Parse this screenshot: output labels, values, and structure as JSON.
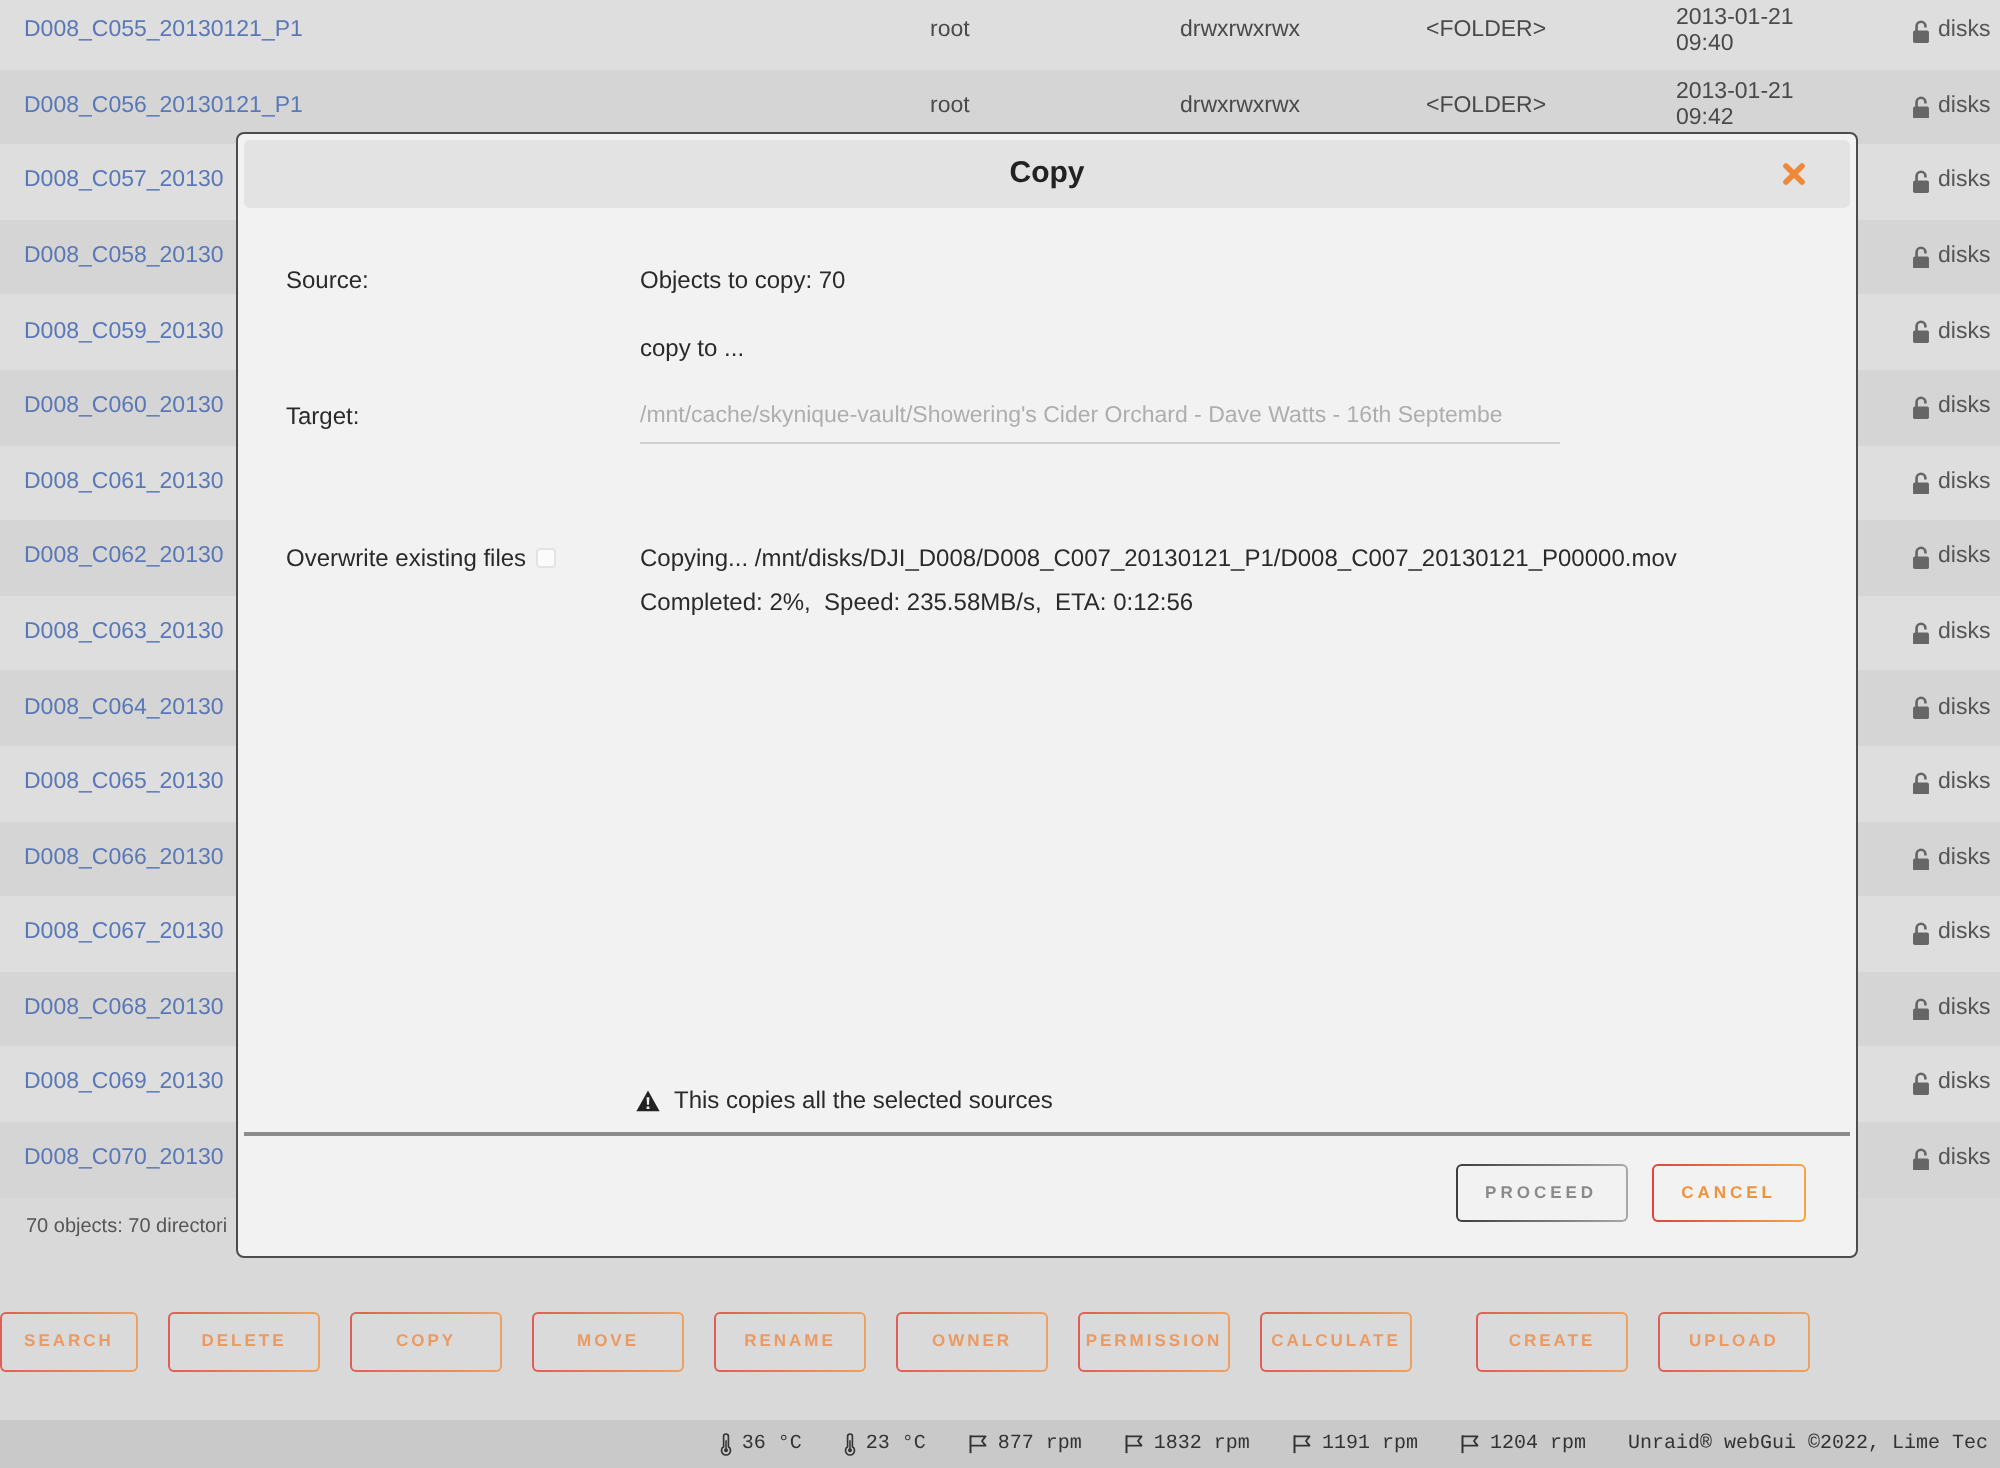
{
  "file_list": {
    "rows": [
      {
        "column_1": "D008_C055_20130121_P1",
        "column_2": "root",
        "column_3": "drwxrwxrwx",
        "column_4": "<FOLDER>",
        "column_5": "2013-01-21 09:40",
        "column_6": "disks"
      },
      {
        "column_1": "D008_C056_20130121_P1",
        "column_2": "root",
        "column_3": "drwxrwxrwx",
        "column_4": "<FOLDER>",
        "column_5": "2013-01-21 09:42",
        "column_6": "disks"
      },
      {
        "column_1": "D008_C057_20130",
        "column_6": "disks"
      },
      {
        "column_1": "D008_C058_20130",
        "column_6": "disks"
      },
      {
        "column_1": "D008_C059_20130",
        "column_6": "disks"
      },
      {
        "column_1": "D008_C060_20130",
        "column_6": "disks"
      },
      {
        "column_1": "D008_C061_20130",
        "column_6": "disks"
      },
      {
        "column_1": "D008_C062_20130",
        "column_6": "disks"
      },
      {
        "column_1": "D008_C063_20130",
        "column_6": "disks"
      },
      {
        "column_1": "D008_C064_20130",
        "column_6": "disks"
      },
      {
        "column_1": "D008_C065_20130",
        "column_6": "disks"
      },
      {
        "column_1": "D008_C066_20130",
        "column_6": "disks"
      },
      {
        "column_1": "D008_C067_20130",
        "column_6": "disks"
      },
      {
        "column_1": "D008_C068_20130",
        "column_6": "disks"
      },
      {
        "column_1": "D008_C069_20130",
        "column_6": "disks"
      },
      {
        "column_1": "D008_C070_20130",
        "column_6": "disks"
      }
    ],
    "summary": "70 objects: 70 directori"
  },
  "action_groups": [
    [
      "SEARCH",
      "DELETE",
      "COPY",
      "MOVE",
      "RENAME",
      "OWNER",
      "PERMISSION",
      "CALCULATE"
    ],
    [
      "CREATE",
      "UPLOAD"
    ]
  ],
  "dialog": {
    "title": "Copy",
    "source": {
      "label": "Source:",
      "value": "Objects to copy: 70"
    },
    "copy_to": "copy to ...",
    "target": {
      "label": "Target:",
      "value": "/mnt/cache/skynique-vault/Showering's Cider Orchard - Dave Watts - 16th Septembe",
      "disabled": true
    },
    "overwrite": {
      "label": "Overwrite existing files",
      "checked": false
    },
    "progress": {
      "file": "Copying... /mnt/disks/DJI_D008/D008_C007_20130121_P1/D008_C007_20130121_P00000.mov",
      "stats": "Completed: 2%,  Speed: 235.58MB/s,  ETA: 0:12:56"
    },
    "warning": "This copies all the selected sources",
    "buttons": [
      {
        "label": "PROCEED",
        "disabled": true
      },
      {
        "label": "CANCEL",
        "disabled": false
      }
    ]
  },
  "status_bar": {
    "items": [
      {
        "kind": "temperature",
        "text": "36 °C"
      },
      {
        "kind": "temperature",
        "text": "23 °C"
      },
      {
        "kind": "fan",
        "text": "877 rpm"
      },
      {
        "kind": "fan",
        "text": "1832 rpm"
      },
      {
        "kind": "fan",
        "text": "1191 rpm"
      },
      {
        "kind": "fan",
        "text": "1204 rpm"
      }
    ],
    "footer": "Unraid® webGui ©2022, Lime Tec"
  }
}
